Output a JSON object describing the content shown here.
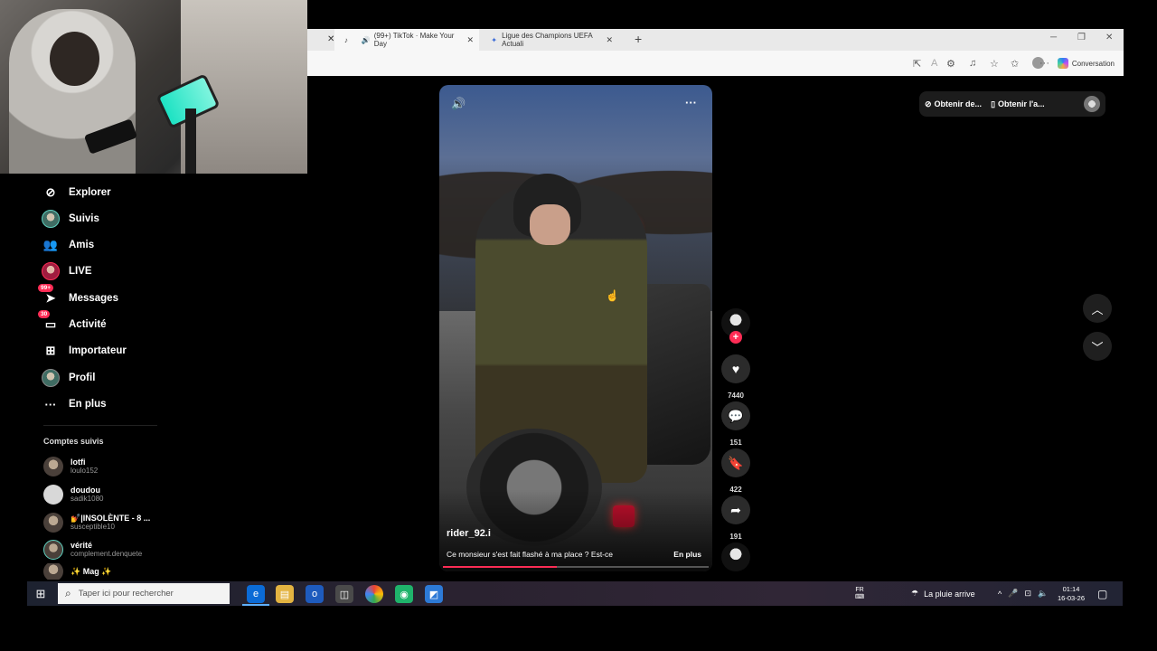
{
  "browser": {
    "tabs": [
      {
        "label": "(99+) TikTok · Make Your Day",
        "icon": "tiktok-icon"
      },
      {
        "label": "Ligue des Champions UEFA Actuali",
        "icon": "uefa-icon"
      }
    ],
    "toolbar": {
      "conversation_label": "Conversation"
    }
  },
  "sidebar": {
    "items": [
      {
        "label": "Explorer",
        "icon": "compass-icon"
      },
      {
        "label": "Suivis",
        "icon": "avatar"
      },
      {
        "label": "Amis",
        "icon": "friends-icon"
      },
      {
        "label": "LIVE",
        "icon": "live-avatar"
      },
      {
        "label": "Messages",
        "icon": "send-icon",
        "badge": "99+"
      },
      {
        "label": "Activité",
        "icon": "inbox-icon",
        "badge": "30"
      },
      {
        "label": "Importateur",
        "icon": "plus-square-icon"
      },
      {
        "label": "Profil",
        "icon": "avatar"
      },
      {
        "label": "En plus",
        "icon": "more-icon"
      }
    ],
    "following_title": "Comptes suivis",
    "following": [
      {
        "name": "lotfi",
        "handle": "loulo152"
      },
      {
        "name": "doudou",
        "handle": "sadik1080"
      },
      {
        "name": "💅|INSOLÈNTE - 8 ...",
        "handle": "susceptible10"
      },
      {
        "name": "vérité",
        "handle": "complement.denquete"
      },
      {
        "name": "✨ Mag ✨",
        "handle": ""
      }
    ]
  },
  "video": {
    "username": "rider_92.i",
    "caption": "Ce monsieur s'est fait flashé à ma place ? Est-ce",
    "more_label": "En plus",
    "progress": 0.43
  },
  "actions": {
    "likes": "7440",
    "comments": "151",
    "saves": "422",
    "shares": "191"
  },
  "top_bar": {
    "pill1": "Obtenir de...",
    "pill2": "Obtenir l'a..."
  },
  "taskbar": {
    "search_placeholder": "Taper ici pour rechercher",
    "language": "FR",
    "weather": "La pluie arrive",
    "time": "01:14",
    "date": "16-03-26"
  },
  "colors": {
    "accent": "#fe2c55",
    "background": "#000000"
  }
}
